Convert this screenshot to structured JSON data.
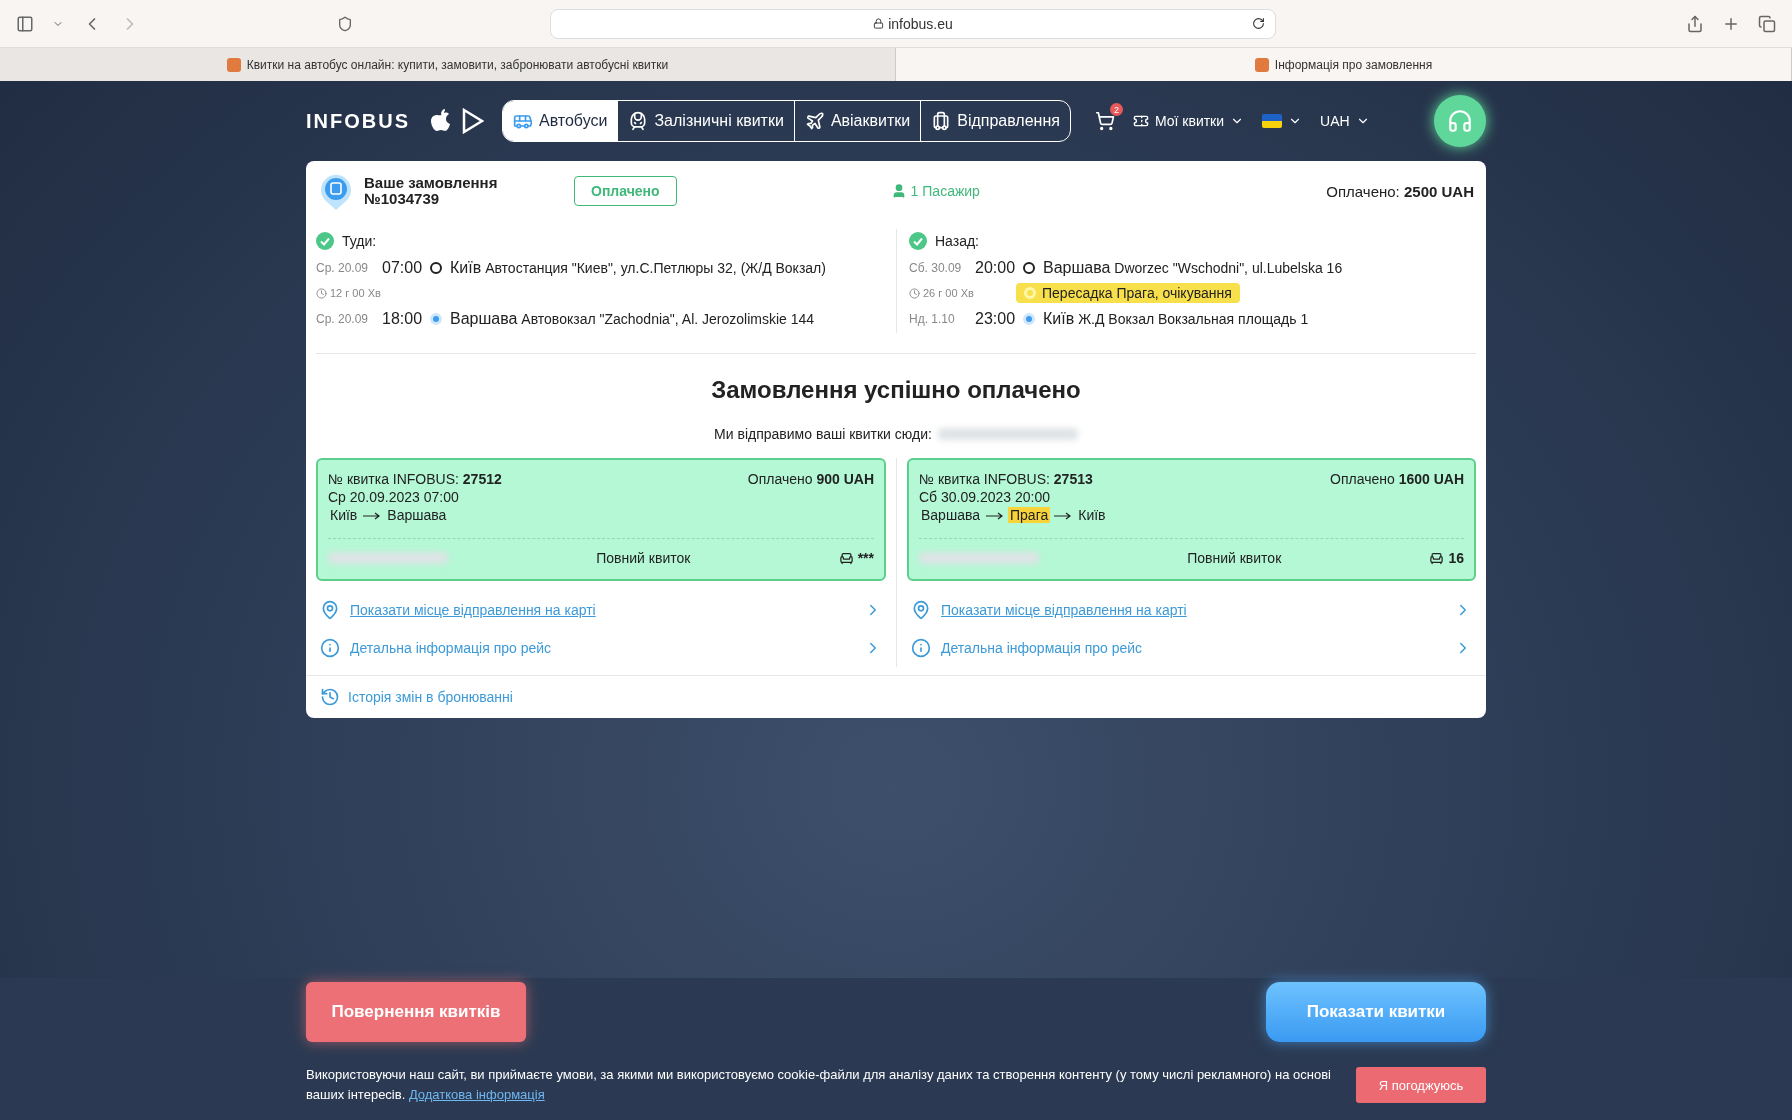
{
  "browser": {
    "url": "infobus.eu",
    "tabs": [
      {
        "title": "Квитки на автобус онлайн: купити, замовити, забронювати автобусні квитки",
        "selected": false
      },
      {
        "title": "Інформація про замовлення",
        "selected": true
      }
    ]
  },
  "nav": {
    "logo": "INFOBUS",
    "modes": [
      {
        "kind": "bus",
        "label": "Автобуси",
        "selected": true
      },
      {
        "kind": "train",
        "label": "Залізничні квитки",
        "selected": false
      },
      {
        "kind": "plane",
        "label": "Авіаквитки",
        "selected": false
      },
      {
        "kind": "luggage",
        "label": "Відправлення",
        "selected": false
      }
    ],
    "cart_count": "2",
    "my_tickets": "Мої квитки",
    "currency": "UAH"
  },
  "order": {
    "title": "Ваше замовлення",
    "number": "№1034739",
    "status": "Оплачено",
    "passengers": "1 Пасажир",
    "paid": "Оплачено: **2500 UAH**"
  },
  "legs": [
    {
      "label": "Туди:",
      "duration": "12 г 00 Хв",
      "stops": [
        {
          "kind": "start",
          "date": "Ср. 20.09",
          "time": "07:00",
          "city": "Київ",
          "address": "Автостанция \"Киев\", ул.С.Петлюры 32, (Ж/Д Вокзал)"
        },
        {
          "kind": "end",
          "date": "Ср. 20.09",
          "time": "18:00",
          "city": "Варшава",
          "address": "Автовокзал \"Zachodnia\", Al. Jerozolimskie 144"
        }
      ]
    },
    {
      "label": "Назад:",
      "duration": "26 г 00 Хв",
      "transfer": "Пересадка Прага, очікування",
      "stops": [
        {
          "kind": "start",
          "date": "Сб. 30.09",
          "time": "20:00",
          "city": "Варшава",
          "address": "Dworzec \"Wschodni\", ul.Lubelska 16"
        },
        {
          "kind": "end",
          "date": "Нд. 1.10",
          "time": "23:00",
          "city": "Київ",
          "address": "Ж.Д Вокзал Вокзальная площадь 1"
        }
      ]
    }
  ],
  "success": {
    "title": "Замовлення успішно оплачено",
    "send_text": "Ми відправимо ваші квитки сюди:"
  },
  "tickets": [
    {
      "number": "№ квитка INFOBUS: **27512**",
      "paid": "Оплачено **900 UAH**",
      "datetime": "Ср 20.09.2023 07:00",
      "route": [
        {
          "city": "Київ",
          "highlighted": false
        },
        {
          "city": "Варшава",
          "highlighted": false
        }
      ],
      "type": "Повний квиток",
      "seat": "***",
      "links": [
        {
          "kind": "map",
          "text": "Показати місце відправлення на карті",
          "underlined": true
        },
        {
          "kind": "info",
          "text": "Детальна інформація про рейс",
          "underlined": false
        }
      ]
    },
    {
      "number": "№ квитка INFOBUS: **27513**",
      "paid": "Оплачено **1600 UAH**",
      "datetime": "Сб 30.09.2023 20:00",
      "route": [
        {
          "city": "Варшава",
          "highlighted": false
        },
        {
          "city": "Прага",
          "highlighted": true
        },
        {
          "city": "Київ",
          "highlighted": false
        }
      ],
      "type": "Повний квиток",
      "seat": "16",
      "links": [
        {
          "kind": "map",
          "text": "Показати місце відправлення на карті",
          "underlined": true
        },
        {
          "kind": "info",
          "text": "Детальна інформація про рейс",
          "underlined": false
        }
      ]
    }
  ],
  "history": "Історія змін в бронюванні",
  "actions": {
    "refund": "Повернення квитків",
    "show": "Показати квитки"
  },
  "cookie": {
    "text": "Використовуючи наш сайт, ви приймаєте умови, за якими ми використовуємо cookie-файли для аналізу даних та створення контенту (у тому числі рекламного) на основі ваших інтересів.",
    "link": "Додаткова інформація",
    "accept": "Я погоджуюсь"
  }
}
